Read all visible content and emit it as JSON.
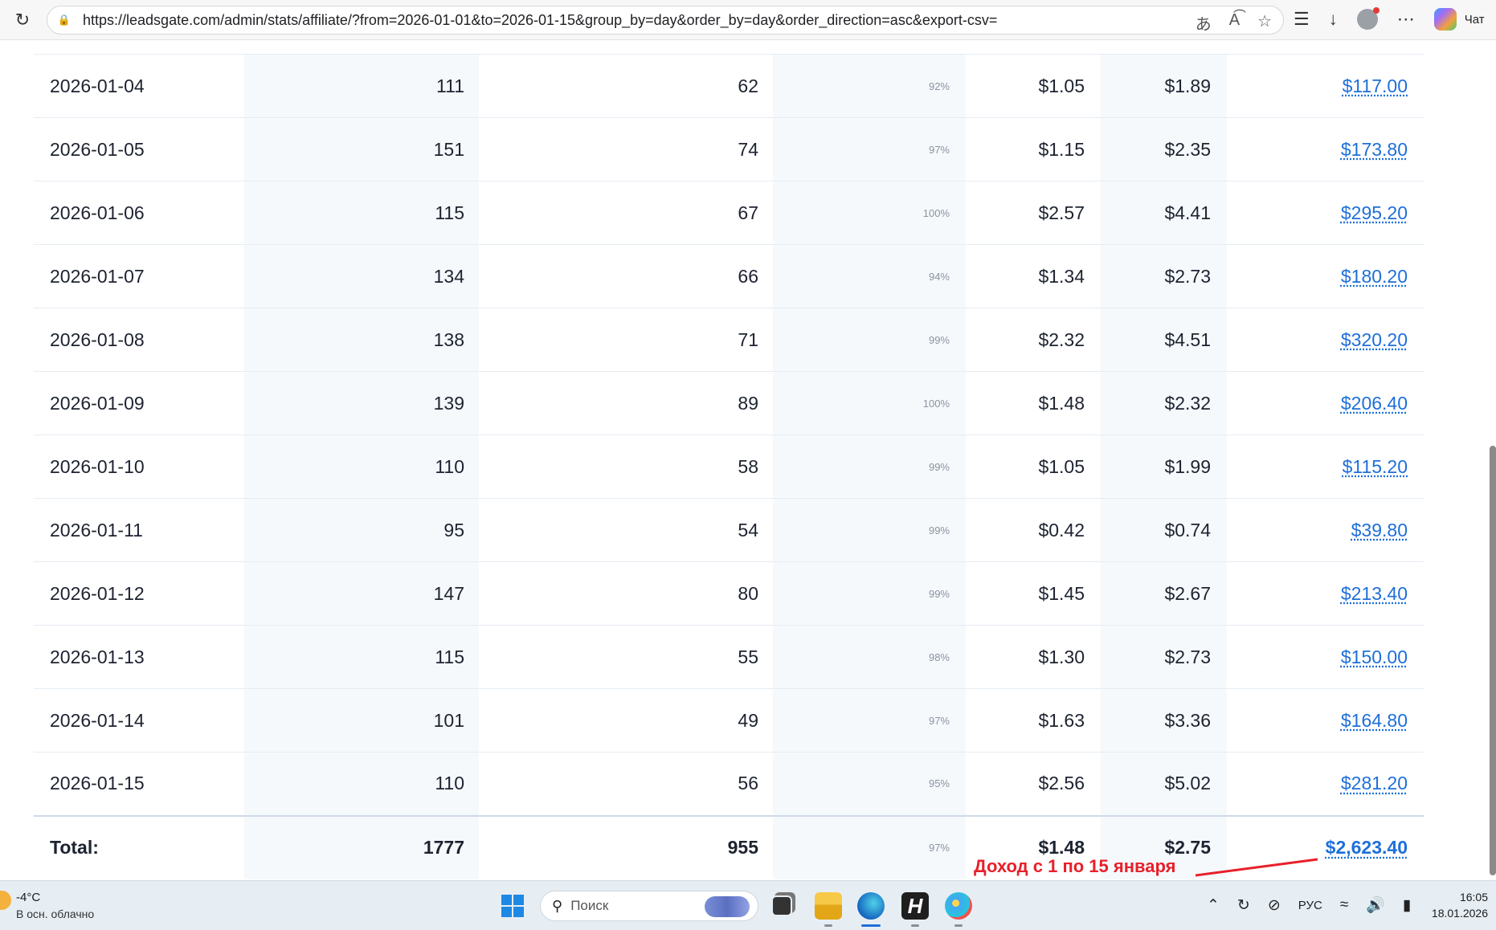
{
  "browser": {
    "url": "https://leadsgate.com/admin/stats/affiliate/?from=2026-01-01&to=2026-01-15&group_by=day&order_by=day&order_direction=asc&export-csv=",
    "chat_label": "Чат"
  },
  "table": {
    "rows": [
      {
        "date": "2026-01-04",
        "clicks": "111",
        "leads": "62",
        "pct": "92%",
        "epc": "$1.05",
        "epl": "$1.89",
        "revenue": "$117.00"
      },
      {
        "date": "2026-01-05",
        "clicks": "151",
        "leads": "74",
        "pct": "97%",
        "epc": "$1.15",
        "epl": "$2.35",
        "revenue": "$173.80"
      },
      {
        "date": "2026-01-06",
        "clicks": "115",
        "leads": "67",
        "pct": "100%",
        "epc": "$2.57",
        "epl": "$4.41",
        "revenue": "$295.20"
      },
      {
        "date": "2026-01-07",
        "clicks": "134",
        "leads": "66",
        "pct": "94%",
        "epc": "$1.34",
        "epl": "$2.73",
        "revenue": "$180.20"
      },
      {
        "date": "2026-01-08",
        "clicks": "138",
        "leads": "71",
        "pct": "99%",
        "epc": "$2.32",
        "epl": "$4.51",
        "revenue": "$320.20"
      },
      {
        "date": "2026-01-09",
        "clicks": "139",
        "leads": "89",
        "pct": "100%",
        "epc": "$1.48",
        "epl": "$2.32",
        "revenue": "$206.40"
      },
      {
        "date": "2026-01-10",
        "clicks": "110",
        "leads": "58",
        "pct": "99%",
        "epc": "$1.05",
        "epl": "$1.99",
        "revenue": "$115.20"
      },
      {
        "date": "2026-01-11",
        "clicks": "95",
        "leads": "54",
        "pct": "99%",
        "epc": "$0.42",
        "epl": "$0.74",
        "revenue": "$39.80"
      },
      {
        "date": "2026-01-12",
        "clicks": "147",
        "leads": "80",
        "pct": "99%",
        "epc": "$1.45",
        "epl": "$2.67",
        "revenue": "$213.40"
      },
      {
        "date": "2026-01-13",
        "clicks": "115",
        "leads": "55",
        "pct": "98%",
        "epc": "$1.30",
        "epl": "$2.73",
        "revenue": "$150.00"
      },
      {
        "date": "2026-01-14",
        "clicks": "101",
        "leads": "49",
        "pct": "97%",
        "epc": "$1.63",
        "epl": "$3.36",
        "revenue": "$164.80"
      },
      {
        "date": "2026-01-15",
        "clicks": "110",
        "leads": "56",
        "pct": "95%",
        "epc": "$2.56",
        "epl": "$5.02",
        "revenue": "$281.20"
      }
    ],
    "total": {
      "date": "Total:",
      "clicks": "1777",
      "leads": "955",
      "pct": "97%",
      "epc": "$1.48",
      "epl": "$2.75",
      "revenue": "$2,623.40"
    }
  },
  "annotation": {
    "text": "Доход с 1 по 15 января",
    "color": "#e8202a"
  },
  "taskbar": {
    "weather_temp": "-4°C",
    "weather_desc": "В осн. облачно",
    "search_placeholder": "Поиск",
    "language": "РУС",
    "time": "16:05",
    "date": "18.01.2026"
  },
  "colors": {
    "link": "#1e6fd9",
    "stripe": "#f5f9fc",
    "taskbar": "#e6eef4"
  }
}
